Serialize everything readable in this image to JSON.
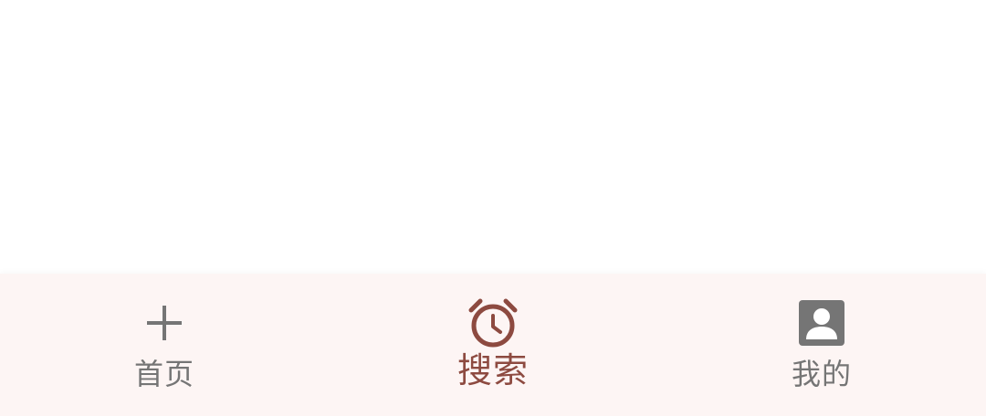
{
  "colors": {
    "nav_background": "#fdf5f4",
    "active": "#8d4a40",
    "inactive": "#757575"
  },
  "bottom_nav": {
    "items": [
      {
        "label": "首页",
        "icon": "plus-icon",
        "active": false
      },
      {
        "label": "搜索",
        "icon": "alarm-clock-icon",
        "active": true
      },
      {
        "label": "我的",
        "icon": "account-box-icon",
        "active": false
      }
    ]
  }
}
